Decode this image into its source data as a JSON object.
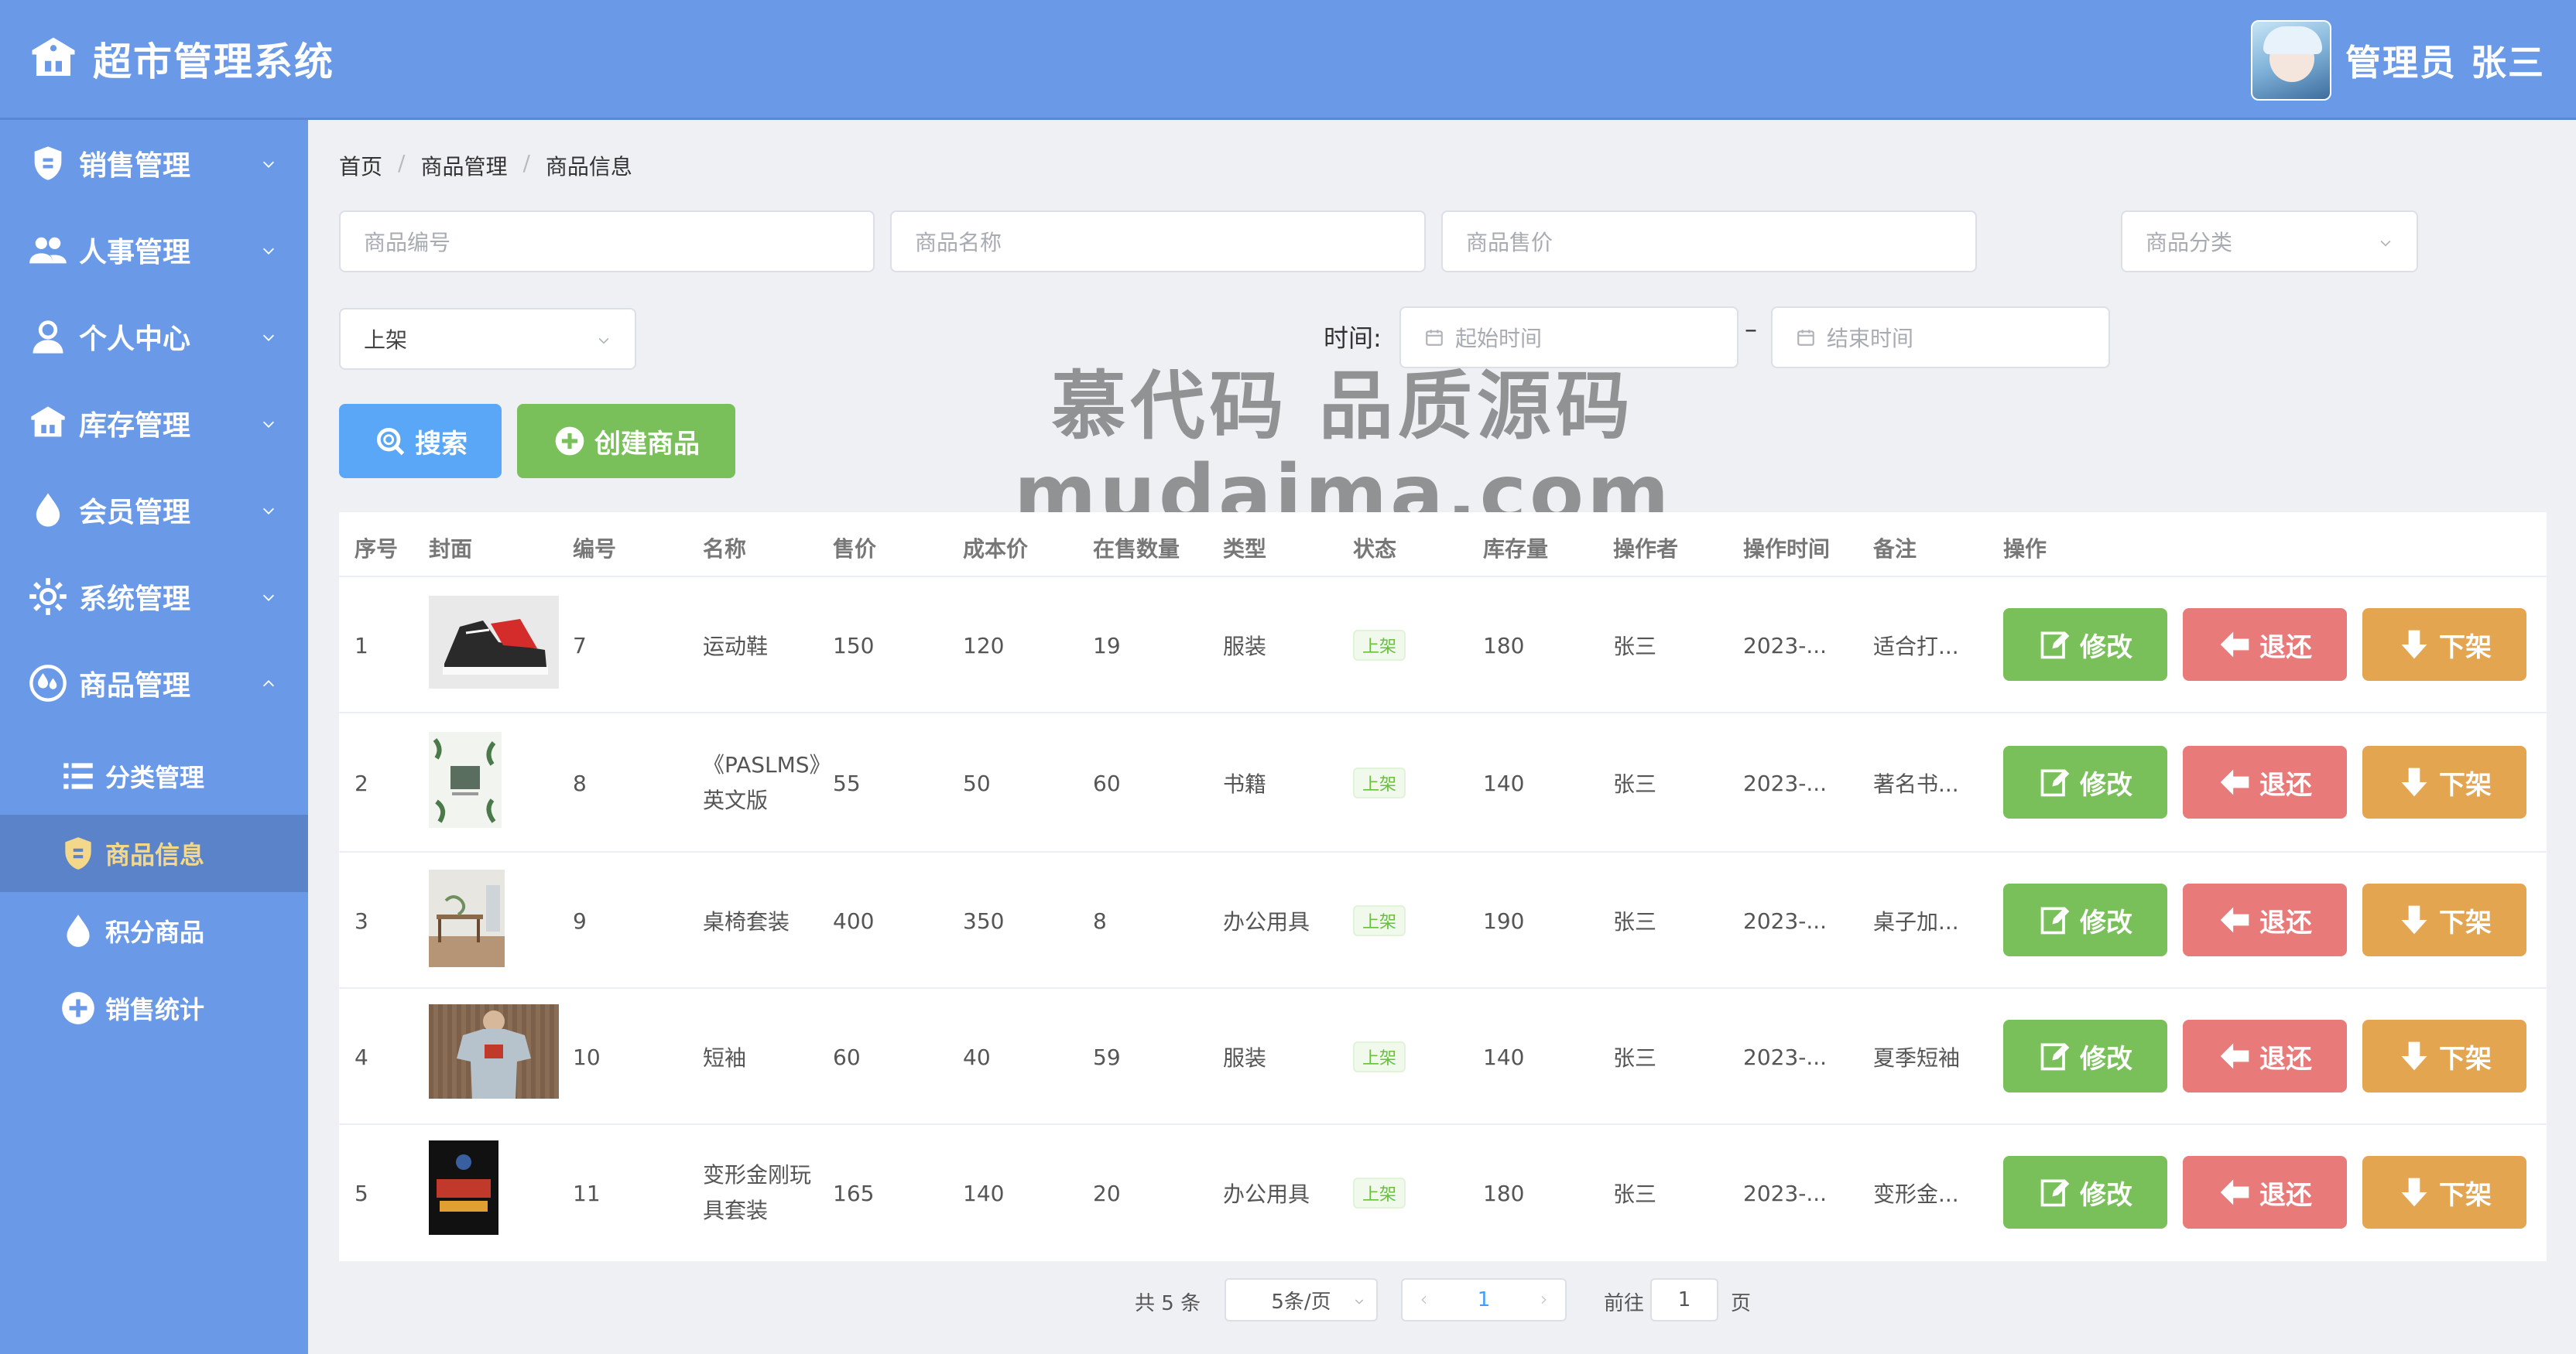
{
  "header": {
    "app_title": "超市管理系统",
    "user_name": "管理员 张三"
  },
  "sidebar": {
    "items": [
      {
        "label": "销售管理",
        "icon": "badge-icon"
      },
      {
        "label": "人事管理",
        "icon": "users-icon"
      },
      {
        "label": "个人中心",
        "icon": "user-icon"
      },
      {
        "label": "库存管理",
        "icon": "warehouse-icon"
      },
      {
        "label": "会员管理",
        "icon": "drop-icon"
      },
      {
        "label": "系统管理",
        "icon": "gear-icon"
      },
      {
        "label": "商品管理",
        "icon": "drops-icon"
      }
    ],
    "subitems": [
      {
        "label": "分类管理",
        "icon": "list-icon"
      },
      {
        "label": "商品信息",
        "icon": "badge-icon"
      },
      {
        "label": "积分商品",
        "icon": "drop-icon"
      },
      {
        "label": "销售统计",
        "icon": "plus-circle-icon"
      }
    ]
  },
  "breadcrumb": [
    "首页",
    "商品管理",
    "商品信息"
  ],
  "filters": {
    "code_placeholder": "商品编号",
    "name_placeholder": "商品名称",
    "price_placeholder": "商品售价",
    "category_placeholder": "商品分类",
    "status_value": "上架",
    "time_label": "时间:",
    "start_placeholder": "起始时间",
    "dash": "–",
    "end_placeholder": "结束时间"
  },
  "buttons": {
    "search": "搜索",
    "create": "创建商品"
  },
  "watermark": {
    "line1": "慕代码 品质源码",
    "line2": "mudaima.com"
  },
  "table": {
    "headers": [
      "序号",
      "封面",
      "编号",
      "名称",
      "售价",
      "成本价",
      "在售数量",
      "类型",
      "状态",
      "库存量",
      "操作者",
      "操作时间",
      "备注",
      "操作"
    ],
    "rows": [
      {
        "idx": "1",
        "code": "7",
        "name": "运动鞋",
        "price": "150",
        "cost": "120",
        "onsale": "19",
        "type": "服装",
        "status": "上架",
        "stock": "180",
        "operator": "张三",
        "time": "2023-...",
        "note": "适合打..."
      },
      {
        "idx": "2",
        "code": "8",
        "name": "《PASLMS》英文版",
        "price": "55",
        "cost": "50",
        "onsale": "60",
        "type": "书籍",
        "status": "上架",
        "stock": "140",
        "operator": "张三",
        "time": "2023-...",
        "note": "著名书..."
      },
      {
        "idx": "3",
        "code": "9",
        "name": "桌椅套装",
        "price": "400",
        "cost": "350",
        "onsale": "8",
        "type": "办公用具",
        "status": "上架",
        "stock": "190",
        "operator": "张三",
        "time": "2023-...",
        "note": "桌子加..."
      },
      {
        "idx": "4",
        "code": "10",
        "name": "短袖",
        "price": "60",
        "cost": "40",
        "onsale": "59",
        "type": "服装",
        "status": "上架",
        "stock": "140",
        "operator": "张三",
        "time": "2023-...",
        "note": "夏季短袖"
      },
      {
        "idx": "5",
        "code": "11",
        "name": "变形金刚玩具套装",
        "price": "165",
        "cost": "140",
        "onsale": "20",
        "type": "办公用具",
        "status": "上架",
        "stock": "180",
        "operator": "张三",
        "time": "2023-...",
        "note": "变形金..."
      }
    ],
    "actions": {
      "edit": "修改",
      "return": "退还",
      "offshelf": "下架"
    }
  },
  "pagination": {
    "total": "共 5 条",
    "page_size": "5条/页",
    "current_page": "1",
    "goto_prefix": "前往",
    "goto_value": "1",
    "goto_suffix": "页"
  },
  "colors": {
    "primary": "#6a99e8",
    "green": "#79c05a",
    "red": "#e97a7a",
    "orange": "#e3a54f",
    "blue": "#59a7f6"
  }
}
